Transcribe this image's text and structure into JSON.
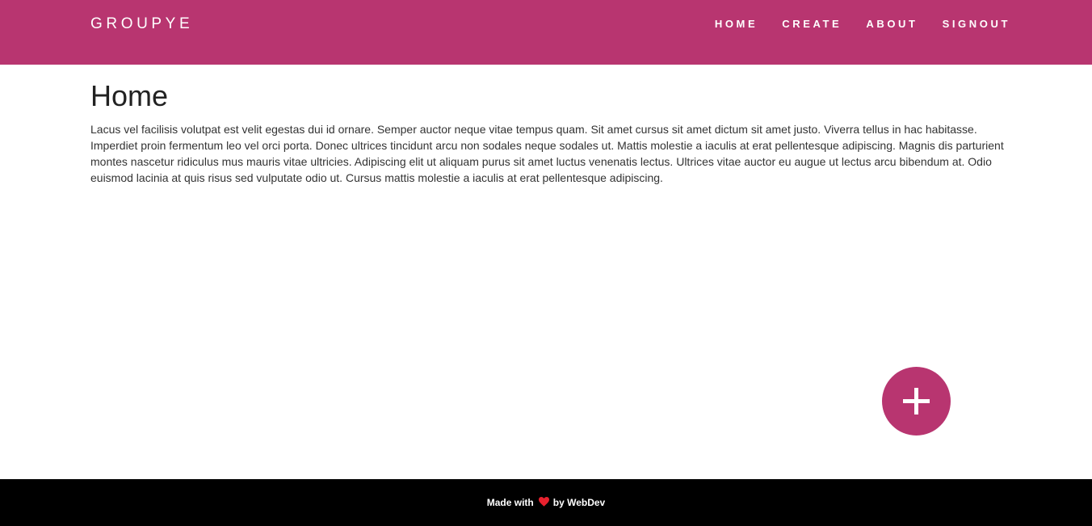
{
  "navbar": {
    "brand": "GROUPYE",
    "links": [
      "HOME",
      "CREATE",
      "ABOUT",
      "SIGNOUT"
    ],
    "background": "#b83570"
  },
  "main": {
    "title": "Home",
    "paragraph": "Lacus vel facilisis volutpat est velit egestas dui id ornare. Semper auctor neque vitae tempus quam. Sit amet cursus sit amet dictum sit amet justo. Viverra tellus in hac habitasse. Imperdiet proin fermentum leo vel orci porta. Donec ultrices tincidunt arcu non sodales neque sodales ut. Mattis molestie a iaculis at erat pellentesque adipiscing. Magnis dis parturient montes nascetur ridiculus mus mauris vitae ultricies. Adipiscing elit ut aliquam purus sit amet luctus venenatis lectus. Ultrices vitae auctor eu augue ut lectus arcu bibendum at. Odio euismod lacinia at quis risus sed vulputate odio ut. Cursus mattis molestie a iaculis at erat pellentesque adipiscing."
  },
  "fab": {
    "icon": "plus-icon",
    "color": "#b83570"
  },
  "footer": {
    "prefix": "Made with",
    "heart_icon": "heart-icon",
    "heart_color": "#e8212e",
    "suffix": "by WebDev",
    "background": "#000000"
  }
}
